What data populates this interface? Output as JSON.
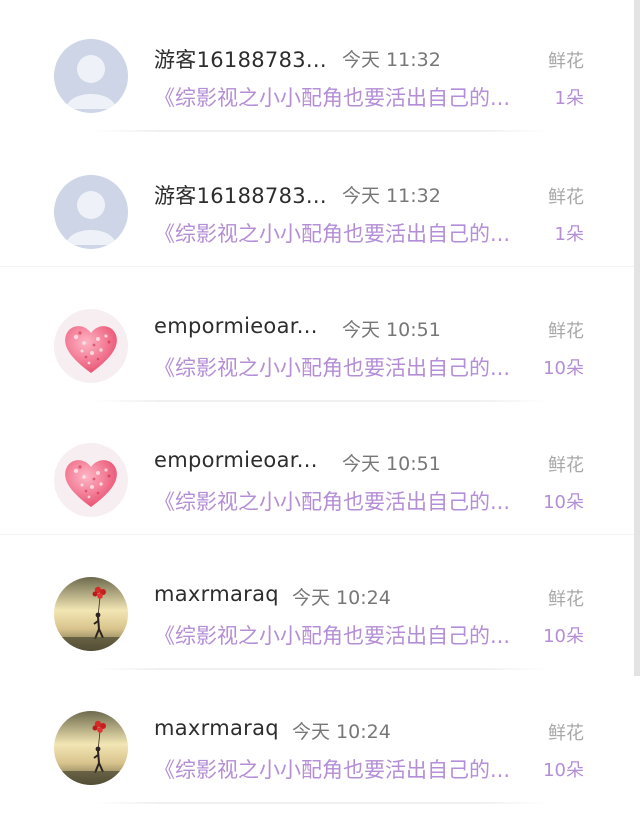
{
  "records": [
    {
      "avatar": "default-person-avatar",
      "username": "游客16188783...",
      "time": "今天 11:32",
      "book_title": "《综影视之小小配角也要活出自己的...",
      "gift_type": "鲜花",
      "gift_count": "1朵"
    },
    {
      "avatar": "default-person-avatar",
      "username": "游客16188783...",
      "time": "今天 11:32",
      "book_title": "《综影视之小小配角也要活出自己的...",
      "gift_type": "鲜花",
      "gift_count": "1朵"
    },
    {
      "avatar": "heart-of-petals-avatar",
      "username": "empormieoar...",
      "time": "今天 10:51",
      "book_title": "《综影视之小小配角也要活出自己的...",
      "gift_type": "鲜花",
      "gift_count": "10朵"
    },
    {
      "avatar": "heart-of-petals-avatar",
      "username": "empormieoar...",
      "time": "今天 10:51",
      "book_title": "《综影视之小小配角也要活出自己的...",
      "gift_type": "鲜花",
      "gift_count": "10朵"
    },
    {
      "avatar": "person-with-balloons-avatar",
      "username": "maxrmaraq",
      "time": "今天 10:24",
      "book_title": "《综影视之小小配角也要活出自己的...",
      "gift_type": "鲜花",
      "gift_count": "10朵"
    },
    {
      "avatar": "person-with-balloons-avatar",
      "username": "maxrmaraq",
      "time": "今天 10:24",
      "book_title": "《综影视之小小配角也要活出自己的...",
      "gift_type": "鲜花",
      "gift_count": "10朵"
    }
  ],
  "colors": {
    "accent_purple": "#b48ed6",
    "username": "#2d2d2d",
    "time": "#777777",
    "gift_label": "#a8a8a8"
  }
}
